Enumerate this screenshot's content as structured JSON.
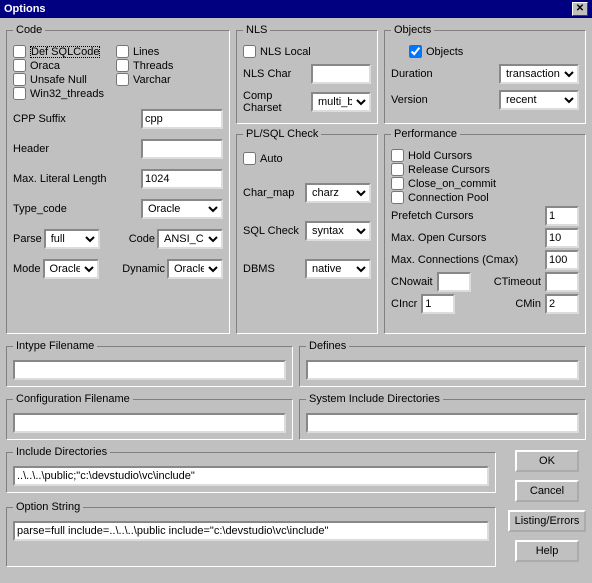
{
  "title": "Options",
  "code": {
    "legend": "Code",
    "defsql": "Def SQLCode",
    "oraca": "Oraca",
    "unsafe": "Unsafe Null",
    "win32": "Win32_threads",
    "lines": "Lines",
    "threads": "Threads",
    "varchar": "Varchar",
    "cpp_suffix_lbl": "CPP Suffix",
    "cpp_suffix": "cpp",
    "header_lbl": "Header",
    "header": "",
    "maxlit_lbl": "Max. Literal Length",
    "maxlit": "1024",
    "typecode_lbl": "Type_code",
    "typecode": "Oracle",
    "parse_lbl": "Parse",
    "parse": "full",
    "codelbl": "Code",
    "codeval": "ANSI_C",
    "mode_lbl": "Mode",
    "mode": "Oracle",
    "dynamic_lbl": "Dynamic",
    "dynamic": "Oracle"
  },
  "nls": {
    "legend": "NLS",
    "local": "NLS Local",
    "char_lbl": "NLS Char",
    "char": "",
    "charset_lbl": "Comp Charset",
    "charset": "multi_byte"
  },
  "plsql": {
    "legend": "PL/SQL Check",
    "auto": "Auto",
    "charmap_lbl": "Char_map",
    "charmap": "charz",
    "sqlcheck_lbl": "SQL Check",
    "sqlcheck": "syntax",
    "dbms_lbl": "DBMS",
    "dbms": "native"
  },
  "objects": {
    "legend": "Objects",
    "objects_cb": "Objects",
    "duration_lbl": "Duration",
    "duration": "transaction",
    "version_lbl": "Version",
    "version": "recent"
  },
  "perf": {
    "legend": "Performance",
    "hold": "Hold Cursors",
    "release": "Release Cursors",
    "close": "Close_on_commit",
    "pool": "Connection Pool",
    "prefetch_lbl": "Prefetch Cursors",
    "prefetch": "1",
    "maxopen_lbl": "Max. Open Cursors",
    "maxopen": "10",
    "maxconn_lbl": "Max. Connections (Cmax)",
    "maxconn": "100",
    "cnowait_lbl": "CNowait",
    "cnowait": "",
    "ctimeout_lbl": "CTimeout",
    "ctimeout": "",
    "cincr_lbl": "CIncr",
    "cincr": "1",
    "cmin_lbl": "CMin",
    "cmin": "2"
  },
  "intype": {
    "legend": "Intype Filename",
    "value": ""
  },
  "defines": {
    "legend": "Defines",
    "value": ""
  },
  "config": {
    "legend": "Configuration Filename",
    "value": ""
  },
  "sysinc": {
    "legend": "System Include Directories",
    "value": ""
  },
  "incdir": {
    "legend": "Include Directories",
    "value": "..\\..\\..\\public;\"c:\\devstudio\\vc\\include\""
  },
  "optstr": {
    "legend": "Option String",
    "value": "parse=full include=..\\..\\..\\public include=\"c:\\devstudio\\vc\\include\""
  },
  "buttons": {
    "ok": "OK",
    "cancel": "Cancel",
    "listing": "Listing/Errors",
    "help": "Help"
  }
}
